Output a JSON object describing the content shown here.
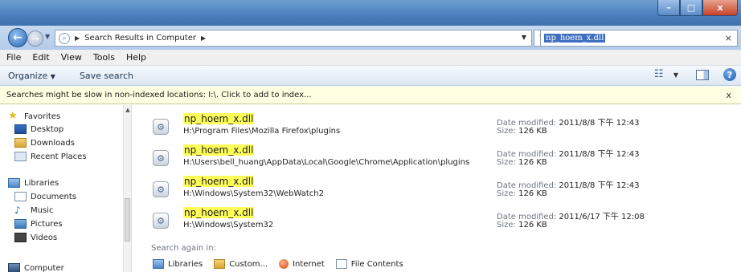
{
  "address": {
    "breadcrumb": "Search Results in Computer"
  },
  "search": {
    "query": "np_hoem_x.dll"
  },
  "window": {
    "minimize": "–",
    "maximize": "□",
    "close": "x"
  },
  "menu": [
    "File",
    "Edit",
    "View",
    "Tools",
    "Help"
  ],
  "toolbar": {
    "organize_label": "Organize",
    "save_search_label": "Save search"
  },
  "infobar": {
    "text": "Searches might be slow in non-indexed locations: I:\\. Click to add to index...",
    "close": "x"
  },
  "navpane": {
    "favorites_label": "Favorites",
    "favorites": [
      "Desktop",
      "Downloads",
      "Recent Places"
    ],
    "libraries_label": "Libraries",
    "libraries": [
      "Documents",
      "Music",
      "Pictures",
      "Videos"
    ],
    "computer_label": "Computer"
  },
  "results": [
    {
      "name": "np_hoem_x.dll",
      "path": "H:\\Program Files\\Mozilla Firefox\\plugins",
      "date_label": "Date modified:",
      "date": "2011/8/8 下午 12:43",
      "size_label": "Size:",
      "size": "126 KB"
    },
    {
      "name": "np_hoem_x.dll",
      "path": "H:\\Users\\bell_huang\\AppData\\Local\\Google\\Chrome\\Application\\plugins",
      "date_label": "Date modified:",
      "date": "2011/8/8 下午 12:43",
      "size_label": "Size:",
      "size": "126 KB"
    },
    {
      "name": "np_hoem_x.dll",
      "path": "H:\\Windows\\System32\\WebWatch2",
      "date_label": "Date modified:",
      "date": "2011/8/8 下午 12:43",
      "size_label": "Size:",
      "size": "126 KB"
    },
    {
      "name": "np_hoem_x.dll",
      "path": "H:\\Windows\\System32",
      "date_label": "Date modified:",
      "date": "2011/6/17 下午 12:08",
      "size_label": "Size:",
      "size": "126 KB"
    }
  ],
  "search_again": {
    "label": "Search again in:",
    "items": [
      "Libraries",
      "Custom...",
      "Internet",
      "File Contents"
    ]
  }
}
